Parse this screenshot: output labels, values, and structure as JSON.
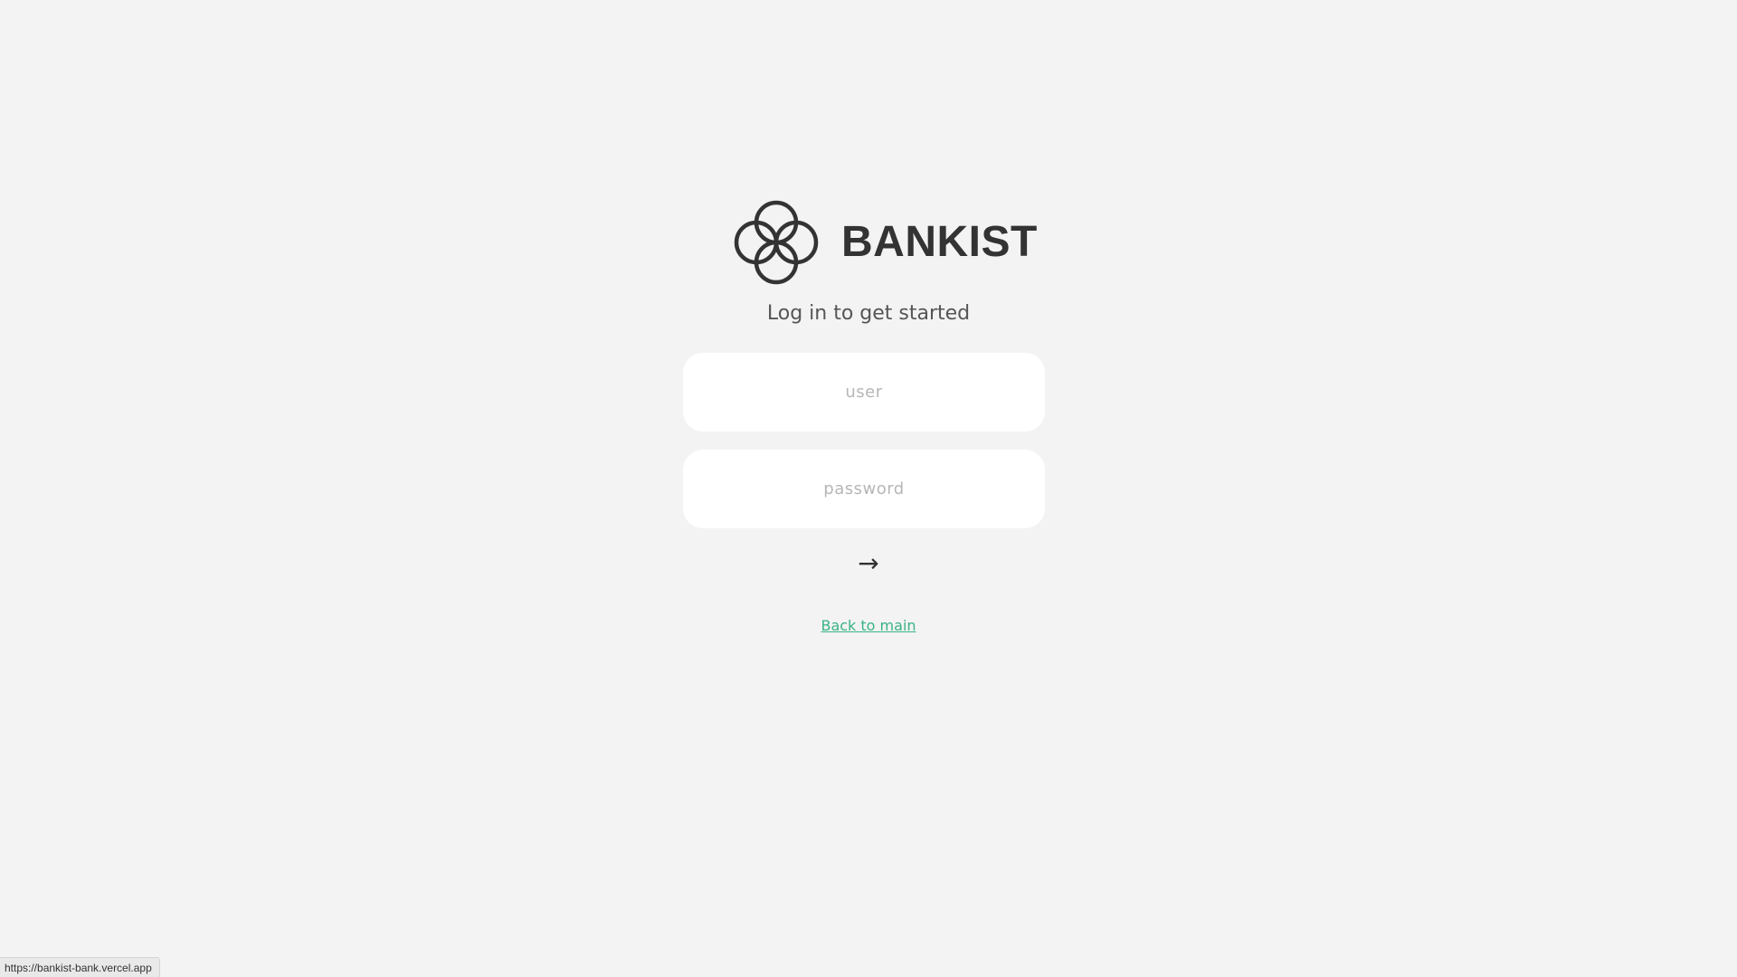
{
  "brand": {
    "name": "BANKIST",
    "logo_icon": "four-rings-logo-icon"
  },
  "login": {
    "subtitle": "Log in to get started",
    "user_placeholder": "user",
    "password_placeholder": "password",
    "submit_label": "→",
    "back_link": "Back to main"
  },
  "status_bar": {
    "url": "https://bankist-bank.vercel.app"
  },
  "colors": {
    "background": "#f3f3f3",
    "text": "#333333",
    "link": "#39b385",
    "input_bg": "#ffffff",
    "placeholder": "#b6b6b6"
  }
}
